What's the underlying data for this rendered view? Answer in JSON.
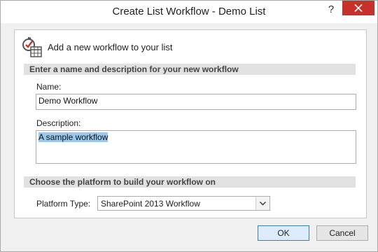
{
  "window": {
    "title": "Create List Workflow - Demo List",
    "help_glyph": "?",
    "close_icon": "close-icon"
  },
  "header": {
    "icon": "workflow-icon",
    "text": "Add a new workflow to your list"
  },
  "section_name": {
    "title": "Enter a name and description for your new workflow"
  },
  "name": {
    "label": "Name:",
    "value": "Demo Workflow"
  },
  "description": {
    "label": "Description:",
    "value": "A sample workflow",
    "selected": true
  },
  "section_platform": {
    "title": "Choose the platform to build your workflow on"
  },
  "platform": {
    "label": "Platform Type:",
    "selected": "SharePoint 2013 Workflow"
  },
  "buttons": {
    "ok": "OK",
    "cancel": "Cancel"
  },
  "colors": {
    "close_button": "#c7312a",
    "selection": "#99c9ef",
    "section_band": "#e1e1e1"
  }
}
